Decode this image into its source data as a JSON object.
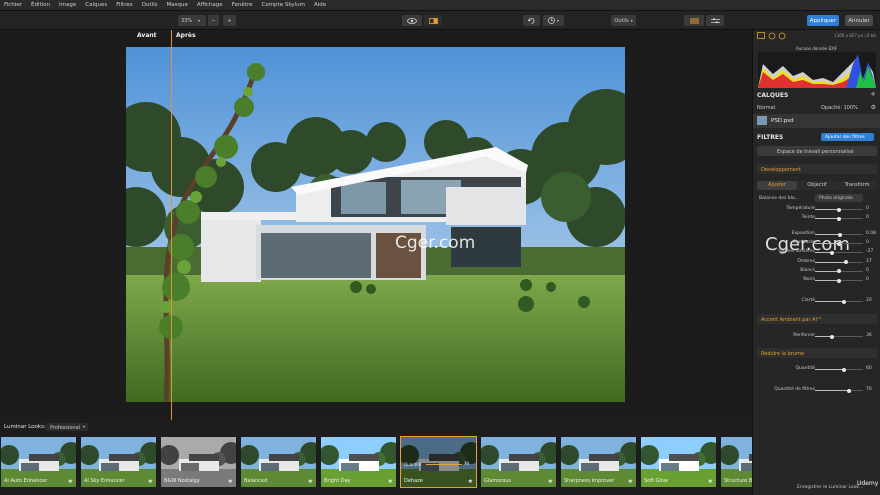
{
  "menu": [
    "Fichier",
    "Édition",
    "Image",
    "Calques",
    "Filtres",
    "Outils",
    "Masque",
    "Affichage",
    "Fenêtre",
    "Compte Skylum",
    "Aide"
  ],
  "toolbar": {
    "zoom": "33%",
    "zoom_minus": "−",
    "zoom_plus": "+",
    "undo_icon": "undo-icon",
    "history_icon": "history-icon",
    "tools_label": "Outils",
    "apply_label": "Appliquer",
    "cancel_label": "Annuler"
  },
  "canvas": {
    "before_label": "Avant",
    "after_label": "Après"
  },
  "watermarks": [
    "Cger.com",
    "Cger.com"
  ],
  "panel": {
    "image_info": "1366 x 827 px  |  8 bit",
    "exif": "Aucune donnée EXIF",
    "layers_title": "CALQUES",
    "blend_mode": "Normal",
    "opacity_label": "Opacité: 100%",
    "layer_name": "PSD.psd",
    "filters_title": "FILTRES",
    "add_filters": "Ajouter des filtres",
    "workspace": "Espace de travail personnalisé",
    "dev_title": "Développement",
    "tabs": [
      "Ajuster",
      "Objectif",
      "Transform"
    ],
    "white_balance_label": "Balance des bla...",
    "white_balance_value": "Photo originale",
    "sliders_dev": [
      {
        "label": "Température",
        "value": "0",
        "pos": 0.5
      },
      {
        "label": "Teinte",
        "value": "0",
        "pos": 0.5
      },
      {
        "label": "Exposition",
        "value": "0.08",
        "pos": 0.52
      },
      {
        "label": "Contraste",
        "value": "0",
        "pos": 0.5
      },
      {
        "label": "Hautes lumières",
        "value": "-27",
        "pos": 0.36
      },
      {
        "label": "Ombres",
        "value": "27",
        "pos": 0.64
      },
      {
        "label": "Blancs",
        "value": "0",
        "pos": 0.5
      },
      {
        "label": "Noirs",
        "value": "0",
        "pos": 0.5
      },
      {
        "label": "Clarté",
        "value": "20",
        "pos": 0.6
      }
    ],
    "accent_title": "Accent Ambiant par AI™",
    "accent_slider": {
      "label": "Renforcer",
      "value": "36",
      "pos": 0.36
    },
    "haze_title": "Réduire la brume",
    "haze_slider": {
      "label": "Quantité",
      "value": "60",
      "pos": 0.6
    },
    "filter_amount": {
      "label": "Quantité de filtres",
      "value": "70",
      "pos": 0.7
    },
    "save_look": "Enregistrer le Luminar Look...",
    "udemy": "Udemy"
  },
  "looks": {
    "title": "Luminar Looks:",
    "category": "Professional",
    "items": [
      {
        "name": "AI Auto Enhancer",
        "tone": "normal"
      },
      {
        "name": "AI Sky Enhancer",
        "tone": "normal"
      },
      {
        "name": "B&W Nostalgy",
        "tone": "bw"
      },
      {
        "name": "Balanced",
        "tone": "normal"
      },
      {
        "name": "Bright Day",
        "tone": "bright"
      },
      {
        "name": "Dehaze",
        "tone": "dark"
      },
      {
        "name": "Glamorous",
        "tone": "normal"
      },
      {
        "name": "Sharpness Improver",
        "tone": "normal"
      },
      {
        "name": "Soft Glow",
        "tone": "bright"
      },
      {
        "name": "Structure B...",
        "tone": "normal"
      }
    ],
    "active_index": 5,
    "active_amount": "Quantité",
    "active_amount_value": "70"
  },
  "colors": {
    "accent": "#2f7fd8",
    "split": "#e0913a",
    "active_look": "#e2a43a"
  }
}
